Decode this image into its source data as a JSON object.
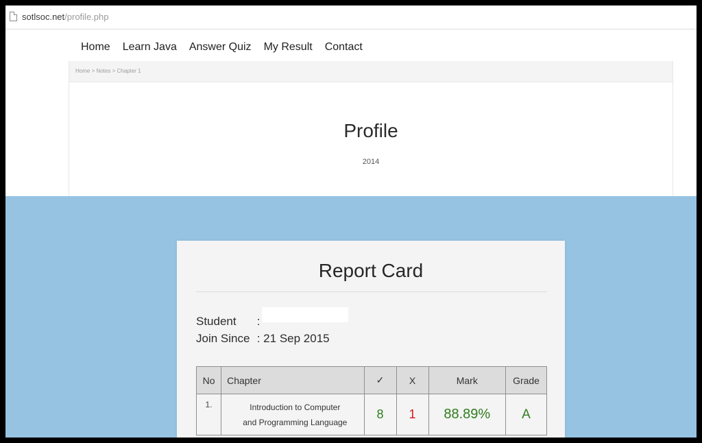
{
  "browser": {
    "url_domain": "sotlsoc.net",
    "url_path": "/profile.php"
  },
  "nav": {
    "items": [
      "Home",
      "Learn Java",
      "Answer Quiz",
      "My Result",
      "Contact"
    ]
  },
  "breadcrumb": "Home > Notes > Chapter 1",
  "profile": {
    "title": "Profile",
    "year": "2014"
  },
  "report_card": {
    "title": "Report Card",
    "student_label": "Student",
    "student_sep": ":",
    "join_label": "Join Since",
    "join_value": ": 21 Sep 2015",
    "table": {
      "headers": {
        "no": "No",
        "chapter": "Chapter",
        "correct": "✓",
        "wrong": "X",
        "mark": "Mark",
        "grade": "Grade"
      },
      "rows": [
        {
          "no": "1.",
          "chapter_line1": "Introduction to Computer",
          "chapter_line2": "and Programming Language",
          "correct": "8",
          "wrong": "1",
          "mark": "88.89%",
          "grade": "A"
        }
      ]
    }
  },
  "colors": {
    "correct": "#2e7d1c",
    "wrong": "#d21b1b",
    "page_background": "#96c3e2"
  }
}
